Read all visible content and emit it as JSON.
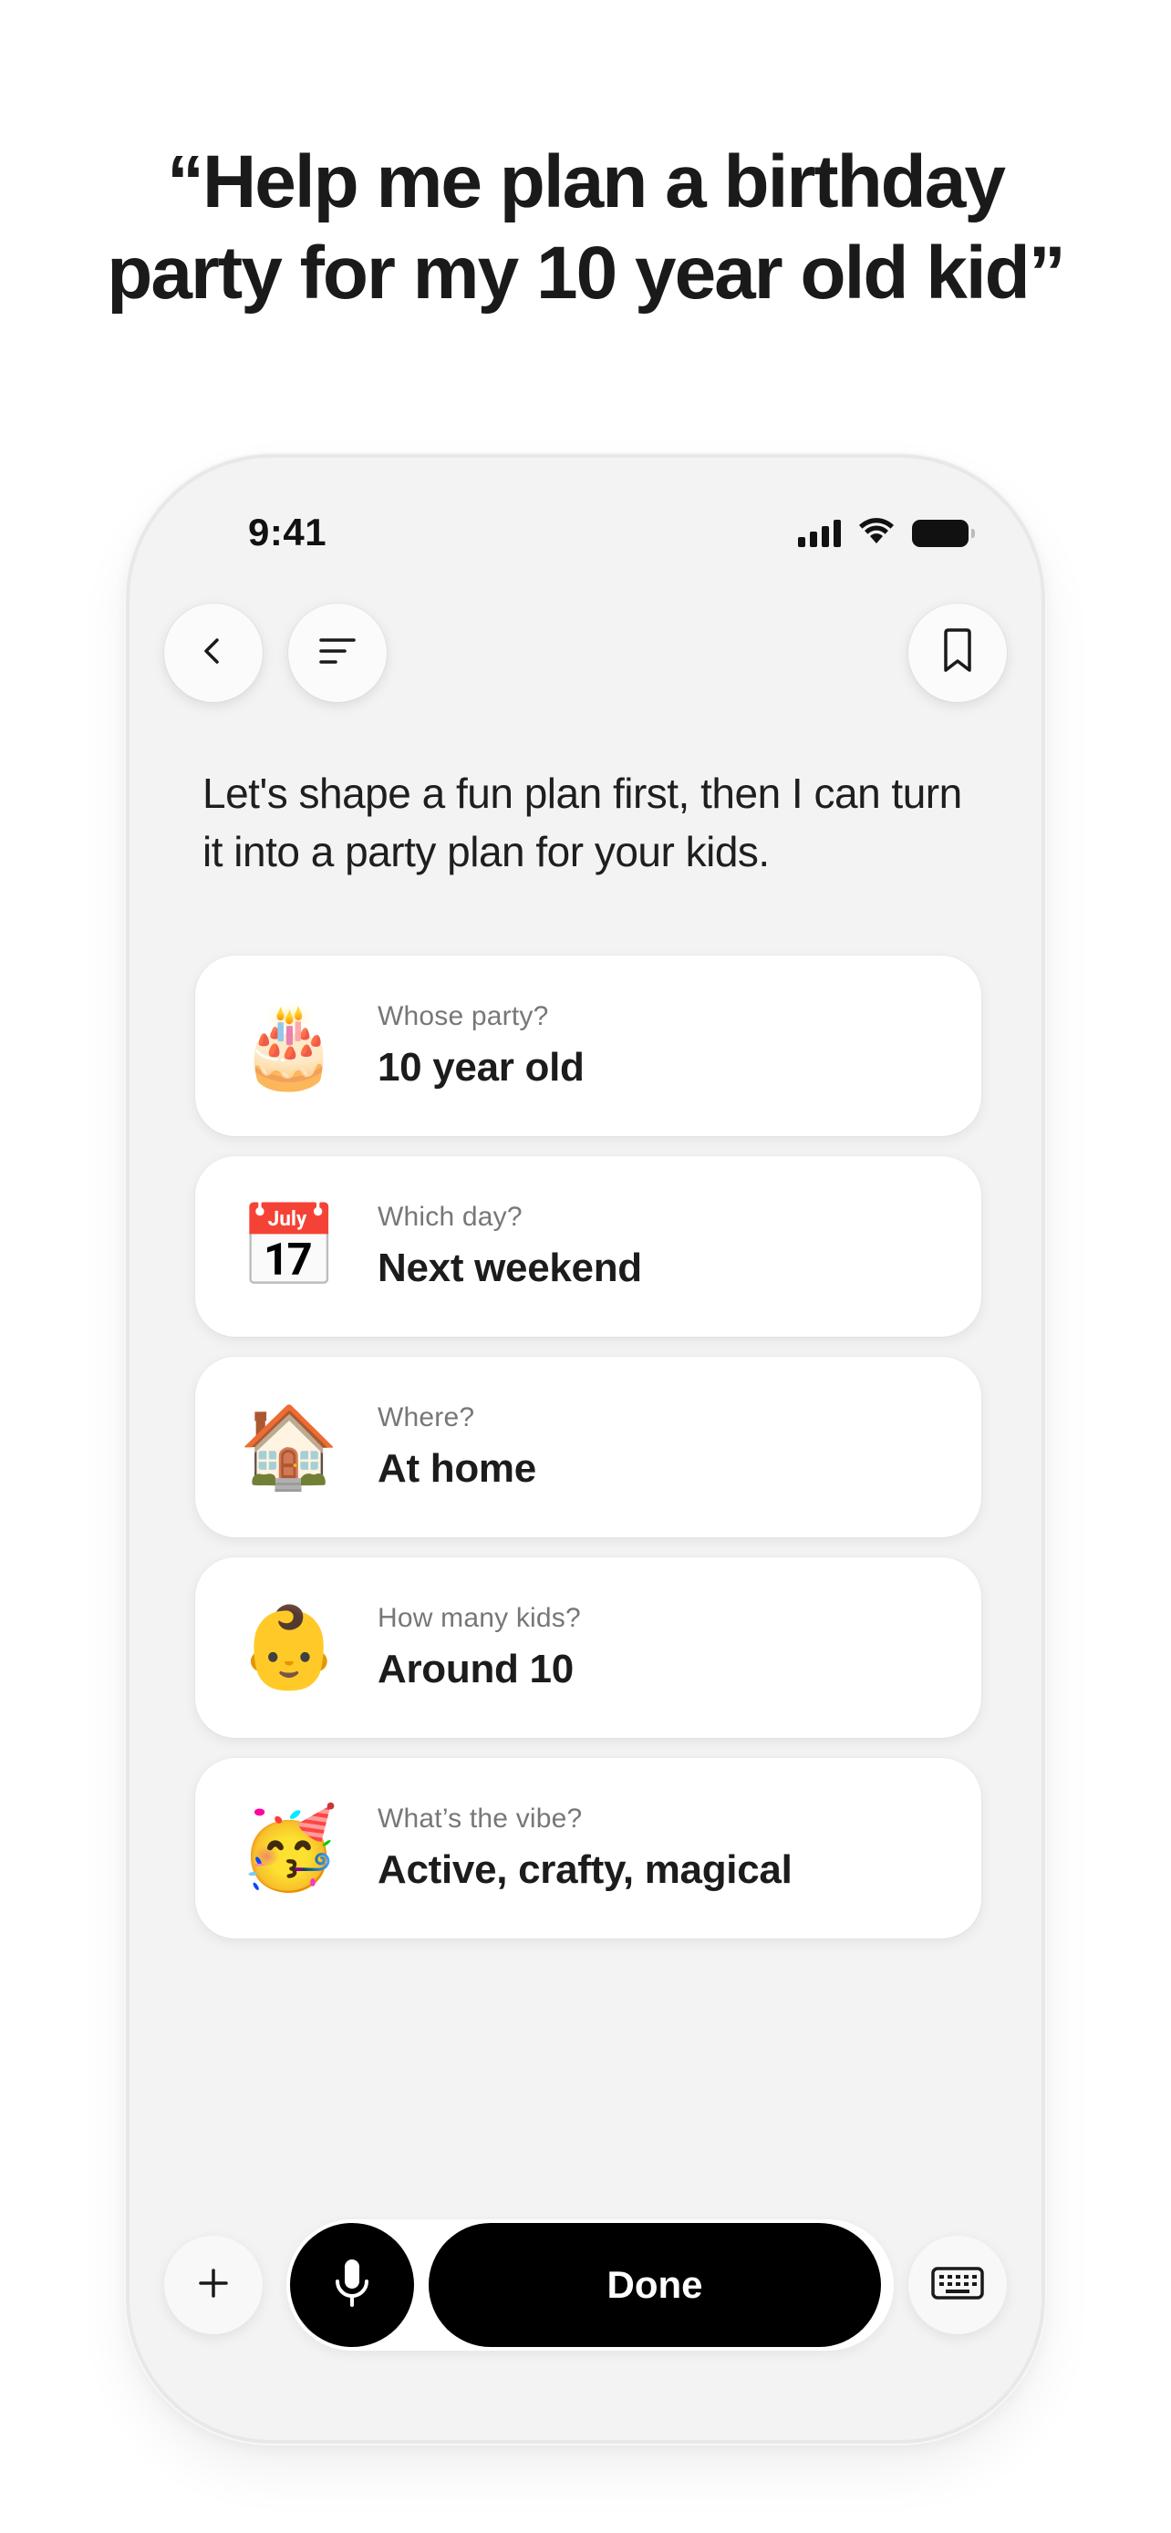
{
  "headline": {
    "line1": "“Help me plan a birthday",
    "line2": "party for my 10 year old kid”"
  },
  "status_bar": {
    "time": "9:41",
    "icons": [
      "signal-icon",
      "wifi-icon",
      "battery-icon"
    ]
  },
  "nav": {
    "icons": [
      "chevron-left-icon",
      "menu-icon",
      "bookmark-icon"
    ]
  },
  "intro_text": "Let's shape a fun plan first, then I can turn it into a party plan for your kids.",
  "cards": [
    {
      "emoji": "🎂",
      "icon": "birthday-cake-icon",
      "label": "Whose party?",
      "value": "10 year old"
    },
    {
      "emoji": "📅",
      "icon": "calendar-icon",
      "label": "Which day?",
      "value": "Next weekend"
    },
    {
      "emoji": "🏠",
      "icon": "house-icon",
      "label": "Where?",
      "value": "At home"
    },
    {
      "emoji": "👶",
      "icon": "child-icon",
      "label": "How many kids?",
      "value": "Around 10"
    },
    {
      "emoji": "🥳",
      "icon": "party-hat-icon",
      "label": "What’s the vibe?",
      "value": "Active, crafty, magical"
    }
  ],
  "bottom_bar": {
    "done_label": "Done",
    "icons": [
      "plus-icon",
      "microphone-icon",
      "keyboard-icon"
    ]
  },
  "colors": {
    "background": "#ffffff",
    "phone_screen": "#f3f3f3",
    "card": "#ffffff",
    "primary_button": "#000000",
    "label_text": "#777777",
    "value_text": "#1c1c1c"
  }
}
